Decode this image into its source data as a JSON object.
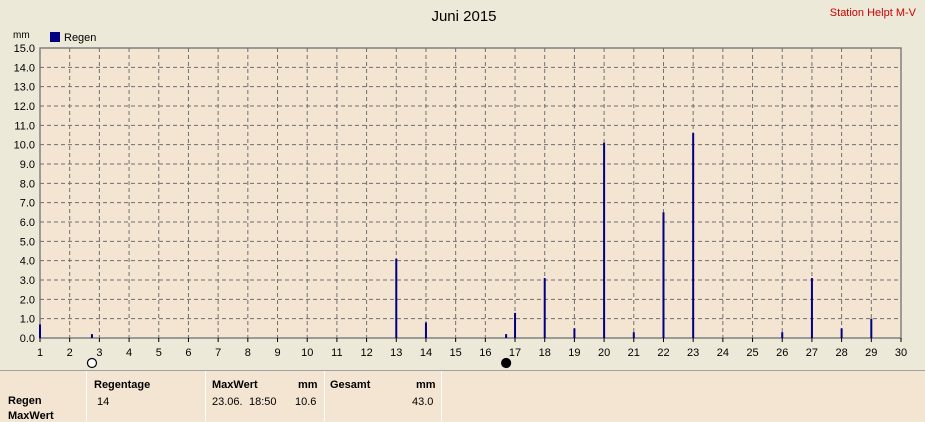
{
  "title": "Juni 2015",
  "station": "Station Helpt M-V",
  "unit": "mm",
  "chart_data": {
    "type": "bar",
    "title": "Juni 2015",
    "ylabel": "mm",
    "xlabel": "",
    "ylim": [
      0,
      15
    ],
    "xlim": [
      1,
      30
    ],
    "grid": true,
    "legend": "top-left",
    "y_ticks": [
      "0.0",
      "1.0",
      "2.0",
      "3.0",
      "4.0",
      "5.0",
      "6.0",
      "7.0",
      "8.0",
      "9.0",
      "10.0",
      "11.0",
      "12.0",
      "13.0",
      "14.0",
      "15.0"
    ],
    "x_ticks": [
      "1",
      "2",
      "3",
      "4",
      "5",
      "6",
      "7",
      "8",
      "9",
      "10",
      "11",
      "12",
      "13",
      "14",
      "15",
      "16",
      "17",
      "18",
      "19",
      "20",
      "21",
      "22",
      "23",
      "24",
      "25",
      "26",
      "27",
      "28",
      "29",
      "30"
    ],
    "series": [
      {
        "name": "Regen",
        "color": "#000080",
        "x": [
          1,
          2.75,
          13,
          14,
          16.7,
          17,
          18,
          19,
          20,
          21,
          22,
          23,
          26,
          27,
          28,
          29
        ],
        "values": [
          0.7,
          0.2,
          4.1,
          0.8,
          0.2,
          1.3,
          3.1,
          0.5,
          10.1,
          0.3,
          6.5,
          10.6,
          0.3,
          3.1,
          0.5,
          1.0
        ]
      }
    ],
    "moon_phases": [
      {
        "x": 2.75,
        "phase": "full"
      },
      {
        "x": 16.7,
        "phase": "new"
      }
    ]
  },
  "footer": {
    "row1": "Regen",
    "row2": "MaxWert",
    "regentage_label": "Regentage",
    "regentage_value": "14",
    "maxwert_label": "MaxWert",
    "maxwert_unit": "mm",
    "maxwert_date": "23.06.",
    "maxwert_time": "18:50",
    "maxwert_value": "10.6",
    "gesamt_label": "Gesamt",
    "gesamt_unit": "mm",
    "gesamt_value": "43.0"
  }
}
